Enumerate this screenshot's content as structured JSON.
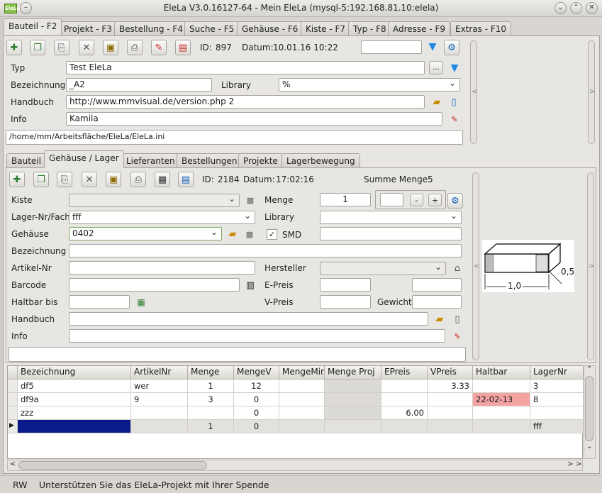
{
  "window": {
    "title": "EleLa V3.0.16127-64  - Mein EleLa (mysql-5:192.168.81.10:elela)",
    "app_icon_text": "EleLa"
  },
  "main_tabs": [
    {
      "label": "Bauteil - F2",
      "active": true
    },
    {
      "label": "Projekt - F3"
    },
    {
      "label": "Bestellung - F4"
    },
    {
      "label": "Suche - F5"
    },
    {
      "label": "Gehäuse - F6"
    },
    {
      "label": "Kiste - F7"
    },
    {
      "label": "Typ - F8"
    },
    {
      "label": "Adresse - F9"
    },
    {
      "label": "Extras - F10"
    }
  ],
  "top_toolbar": {
    "id_label": "ID:",
    "id_value": "897",
    "datum_label": "Datum:",
    "datum_value": "10.01.16 10:22",
    "search_value": ""
  },
  "bauteil_form": {
    "typ_label": "Typ",
    "typ_value": "Test EleLa",
    "bezeichnung_label": "Bezeichnung",
    "bezeichnung_value": "_A2",
    "library_label": "Library",
    "library_value": "%",
    "handbuch_label": "Handbuch",
    "handbuch_value": "http://www.mmvisual.de/version.php 2",
    "info_label": "Info",
    "info_value": "Kamila",
    "path": "/home/mm/Arbeitsfläche/EleLa/EleLa.ini",
    "dots_button": "..."
  },
  "sub_tabs": [
    {
      "label": "Bauteil"
    },
    {
      "label": "Gehäuse / Lager",
      "active": true
    },
    {
      "label": "Lieferanten"
    },
    {
      "label": "Bestellungen"
    },
    {
      "label": "Projekte"
    },
    {
      "label": "Lagerbewegung"
    }
  ],
  "lager_toolbar": {
    "id_label": "ID:",
    "id_value": "2184",
    "datum_label": "Datum:",
    "datum_value": "17:02:16",
    "summe_label": "Summe Menge:",
    "summe_value": "5"
  },
  "lager_form": {
    "kiste_label": "Kiste",
    "kiste_value": "",
    "menge_label": "Menge",
    "menge_value": "1",
    "menge_delta": "",
    "minus": "-",
    "plus": "+",
    "lagernr_label": "Lager-Nr/Fach",
    "lagernr_value": "fff",
    "library_label": "Library",
    "library_value": "",
    "gehaeuse_label": "Gehäuse",
    "gehaeuse_value": "0402",
    "smd_label": "SMD",
    "smd_checked": true,
    "smd_value": "",
    "bezeichnung_label": "Bezeichnung",
    "bezeichnung_value": "",
    "artikelnr_label": "Artikel-Nr",
    "artikelnr_value": "",
    "hersteller_label": "Hersteller",
    "hersteller_value": "",
    "barcode_label": "Barcode",
    "barcode_value": "",
    "epreis_label": "E-Preis",
    "epreis_value": "",
    "epreis_value2": "",
    "haltbar_label": "Haltbar bis",
    "haltbar_value": "",
    "vpreis_label": "V-Preis",
    "vpreis_value": "",
    "gewicht_label": "Gewicht",
    "gewicht_value": "",
    "handbuch_label": "Handbuch",
    "handbuch_value": "",
    "info_label": "Info",
    "info_value": "",
    "memo_value": ""
  },
  "package_drawing": {
    "dim_length": "1,0",
    "dim_width": "0,5"
  },
  "table": {
    "columns": [
      "Bezeichnung",
      "ArtikelNr",
      "Menge",
      "MengeV",
      "MengeMin",
      "Menge Proj",
      "EPreis",
      "VPreis",
      "Haltbar",
      "LagerNr"
    ],
    "rows": [
      [
        "df5",
        "wer",
        "1",
        "12",
        "",
        "",
        "",
        "3.33",
        "",
        "3"
      ],
      [
        "df9a",
        "9",
        "3",
        "0",
        "",
        "",
        "",
        "",
        "22-02-13",
        "8"
      ],
      [
        "zzz",
        "",
        "",
        "0",
        "",
        "",
        "6.00",
        "",
        "",
        ""
      ],
      [
        "",
        "",
        "1",
        "0",
        "",
        "",
        "",
        "",
        "",
        "fff"
      ]
    ],
    "highlight_color": "#f4a3a3",
    "selection_color": "#0a1a8a"
  },
  "status": {
    "mode": "RW",
    "message": "Unterstützen Sie das EleLa-Projekt mit Ihrer Spende"
  }
}
